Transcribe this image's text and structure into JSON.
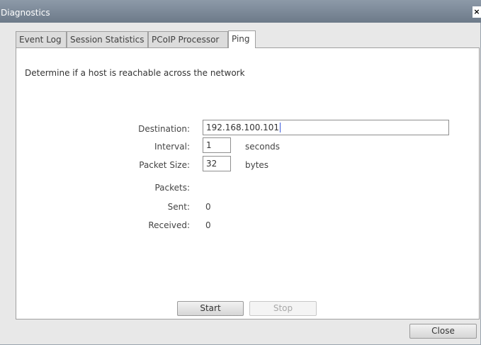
{
  "window": {
    "title": "Diagnostics",
    "close_glyph": "×"
  },
  "tabs": [
    {
      "label": "Event Log"
    },
    {
      "label": "Session Statistics"
    },
    {
      "label": "PCoIP Processor"
    },
    {
      "label": "Ping",
      "active": true
    }
  ],
  "ping": {
    "description": "Determine if a host is reachable across the network",
    "destination": {
      "label": "Destination:",
      "value": "192.168.100.101"
    },
    "interval": {
      "label": "Interval:",
      "value": "1",
      "unit": "seconds"
    },
    "packet_size": {
      "label": "Packet Size:",
      "value": "32",
      "unit": "bytes"
    },
    "packets": {
      "label": "Packets:"
    },
    "sent": {
      "label": "Sent:",
      "value": "0"
    },
    "received": {
      "label": "Received:",
      "value": "0"
    },
    "start_label": "Start",
    "stop_label": "Stop"
  },
  "footer": {
    "close_label": "Close"
  },
  "colors": {
    "titlebar": "#7a8795",
    "caret": "#3b5bdb"
  },
  "icons": {
    "close": "close-icon"
  }
}
